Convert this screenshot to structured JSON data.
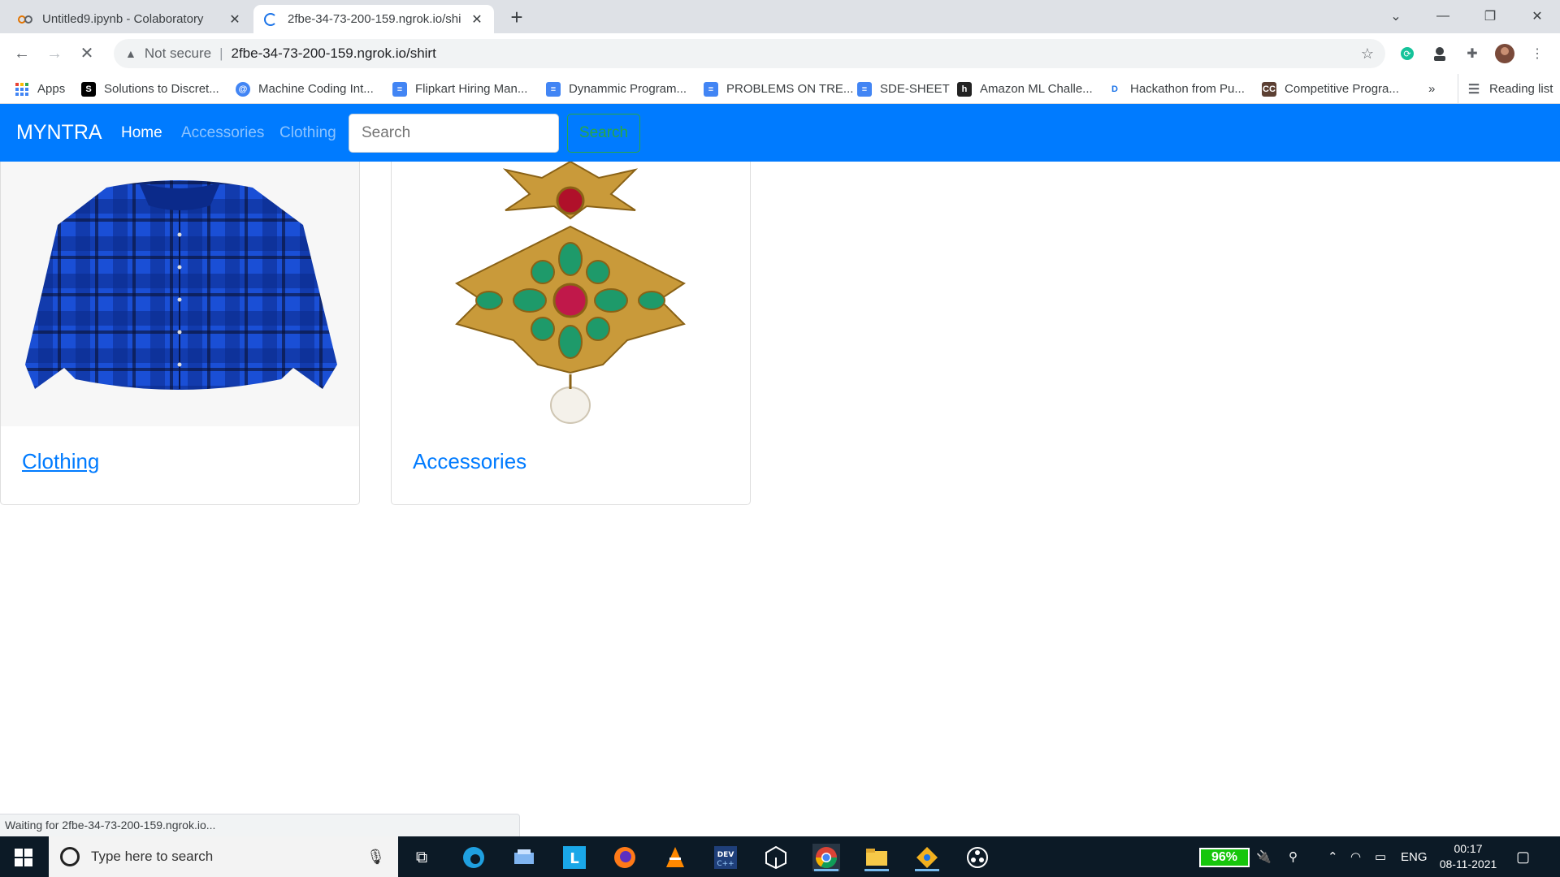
{
  "browser": {
    "tabs": [
      {
        "title": "Untitled9.ipynb - Colaboratory",
        "active": false
      },
      {
        "title": "2fbe-34-73-200-159.ngrok.io/shi",
        "active": true
      }
    ],
    "address": {
      "security_label": "Not secure",
      "url": "2fbe-34-73-200-159.ngrok.io/shirt"
    },
    "bookmarks": [
      {
        "label": "Apps",
        "icon": "apps-grid-icon"
      },
      {
        "label": "Solutions to Discret...",
        "icon": "s-bookmark-icon"
      },
      {
        "label": "Machine Coding Int...",
        "icon": "at-bookmark-icon"
      },
      {
        "label": "Flipkart Hiring Man...",
        "icon": "doc-icon"
      },
      {
        "label": "Dynammic Program...",
        "icon": "doc-icon"
      },
      {
        "label": "PROBLEMS ON TRE...",
        "icon": "doc-icon"
      },
      {
        "label": "SDE-SHEET",
        "icon": "doc-icon"
      },
      {
        "label": "Amazon ML Challe...",
        "icon": "h-bookmark-icon"
      },
      {
        "label": "Hackathon from Pu...",
        "icon": "dc-bookmark-icon"
      },
      {
        "label": "Competitive Progra...",
        "icon": "cc-bookmark-icon"
      }
    ],
    "overflow_label": "»",
    "reading_list_label": "Reading list",
    "status_text": "Waiting for 2fbe-34-73-200-159.ngrok.io..."
  },
  "navbar": {
    "brand": "MYNTRA",
    "links": [
      {
        "label": "Home",
        "active": true
      },
      {
        "label": "Accessories",
        "active": false
      },
      {
        "label": "Clothing",
        "active": false
      }
    ],
    "search_placeholder": "Search",
    "search_button": "Search",
    "accent": "#007bff",
    "success": "#28a745"
  },
  "cards": [
    {
      "title": "Clothing",
      "image": "plaid-shirt-image",
      "underlined": true
    },
    {
      "title": "Accessories",
      "image": "gold-earring-image",
      "underlined": false
    }
  ],
  "taskbar": {
    "search_placeholder": "Type here to search",
    "battery": "96%",
    "language": "ENG",
    "time": "00:17",
    "date": "08-11-2021"
  }
}
